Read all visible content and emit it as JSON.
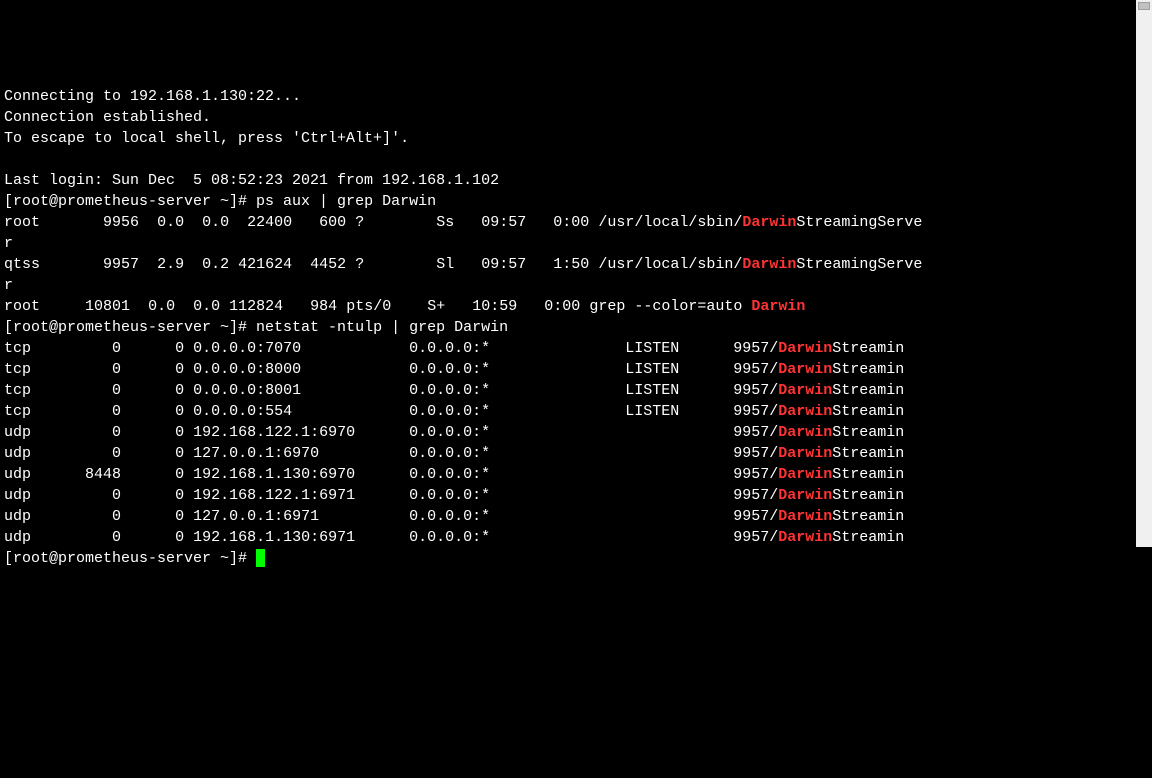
{
  "intro": {
    "line1": "Connecting to 192.168.1.130:22...",
    "line2": "Connection established.",
    "line3": "To escape to local shell, press 'Ctrl+Alt+]'.",
    "line4": "",
    "line5": "Last login: Sun Dec  5 08:52:23 2021 from 192.168.1.102"
  },
  "prompt": "[root@prometheus-server ~]# ",
  "cmd1": "ps aux | grep Darwin",
  "ps": {
    "r1": {
      "user": "root",
      "pid": "9956",
      "cpu": "0.0",
      "mem": "0.0",
      "vsz": "22400",
      "rss": "600",
      "tty": "?",
      "stat": "Ss",
      "start": "09:57",
      "time": "0:00",
      "cmdPre": "/usr/local/sbin/",
      "hl": "Darwin",
      "cmdPost": "StreamingServe",
      "wrap": "r"
    },
    "r2": {
      "user": "qtss",
      "pid": "9957",
      "cpu": "2.9",
      "mem": "0.2",
      "vsz": "421624",
      "rss": "4452",
      "tty": "?",
      "stat": "Sl",
      "start": "09:57",
      "time": "1:50",
      "cmdPre": "/usr/local/sbin/",
      "hl": "Darwin",
      "cmdPost": "StreamingServe",
      "wrap": "r"
    },
    "r3": {
      "user": "root",
      "pid": "10801",
      "cpu": "0.0",
      "mem": "0.0",
      "vsz": "112824",
      "rss": "984",
      "tty": "pts/0",
      "stat": "S+",
      "start": "10:59",
      "time": "0:00",
      "cmdPre": "grep --color=auto ",
      "hl": "Darwin",
      "cmdPost": "",
      "wrap": ""
    }
  },
  "cmd2": "netstat -ntulp | grep Darwin",
  "ns": {
    "r1": {
      "proto": "tcp",
      "recv": "0",
      "send": "0",
      "local": "0.0.0.0:7070",
      "foreign": "0.0.0.0:*",
      "state": "LISTEN",
      "pidPre": "9957/",
      "hl": "Darwin",
      "pidPost": "Streamin"
    },
    "r2": {
      "proto": "tcp",
      "recv": "0",
      "send": "0",
      "local": "0.0.0.0:8000",
      "foreign": "0.0.0.0:*",
      "state": "LISTEN",
      "pidPre": "9957/",
      "hl": "Darwin",
      "pidPost": "Streamin"
    },
    "r3": {
      "proto": "tcp",
      "recv": "0",
      "send": "0",
      "local": "0.0.0.0:8001",
      "foreign": "0.0.0.0:*",
      "state": "LISTEN",
      "pidPre": "9957/",
      "hl": "Darwin",
      "pidPost": "Streamin"
    },
    "r4": {
      "proto": "tcp",
      "recv": "0",
      "send": "0",
      "local": "0.0.0.0:554",
      "foreign": "0.0.0.0:*",
      "state": "LISTEN",
      "pidPre": "9957/",
      "hl": "Darwin",
      "pidPost": "Streamin"
    },
    "r5": {
      "proto": "udp",
      "recv": "0",
      "send": "0",
      "local": "192.168.122.1:6970",
      "foreign": "0.0.0.0:*",
      "state": "",
      "pidPre": "9957/",
      "hl": "Darwin",
      "pidPost": "Streamin"
    },
    "r6": {
      "proto": "udp",
      "recv": "0",
      "send": "0",
      "local": "127.0.0.1:6970",
      "foreign": "0.0.0.0:*",
      "state": "",
      "pidPre": "9957/",
      "hl": "Darwin",
      "pidPost": "Streamin"
    },
    "r7": {
      "proto": "udp",
      "recv": "8448",
      "send": "0",
      "local": "192.168.1.130:6970",
      "foreign": "0.0.0.0:*",
      "state": "",
      "pidPre": "9957/",
      "hl": "Darwin",
      "pidPost": "Streamin"
    },
    "r8": {
      "proto": "udp",
      "recv": "0",
      "send": "0",
      "local": "192.168.122.1:6971",
      "foreign": "0.0.0.0:*",
      "state": "",
      "pidPre": "9957/",
      "hl": "Darwin",
      "pidPost": "Streamin"
    },
    "r9": {
      "proto": "udp",
      "recv": "0",
      "send": "0",
      "local": "127.0.0.1:6971",
      "foreign": "0.0.0.0:*",
      "state": "",
      "pidPre": "9957/",
      "hl": "Darwin",
      "pidPost": "Streamin"
    },
    "r10": {
      "proto": "udp",
      "recv": "0",
      "send": "0",
      "local": "192.168.1.130:6971",
      "foreign": "0.0.0.0:*",
      "state": "",
      "pidPre": "9957/",
      "hl": "Darwin",
      "pidPost": "Streamin"
    }
  }
}
